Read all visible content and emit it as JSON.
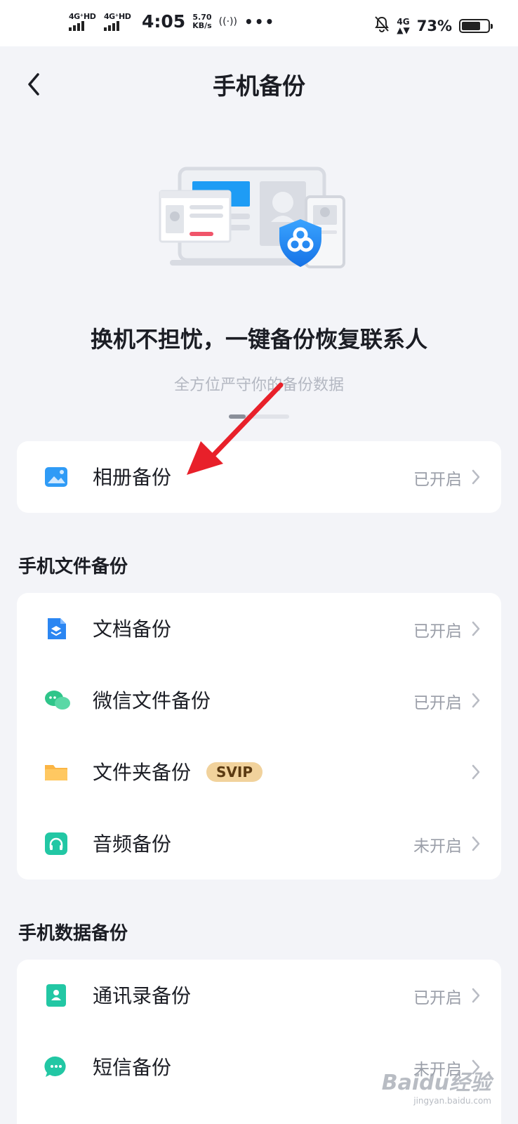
{
  "status_bar": {
    "sim1": "4G⁺HD",
    "sim2": "4G⁺HD",
    "time": "4:05",
    "speed_value": "5.70",
    "speed_unit": "KB/s",
    "more": "•••",
    "data_net": "4G",
    "battery_percent": "73%",
    "battery_level": 0.73
  },
  "header": {
    "title": "手机备份"
  },
  "hero": {
    "headline": "换机不担忧，一键备份恢复联系人",
    "subline": "全方位严守你的备份数据"
  },
  "top_card": {
    "items": [
      {
        "label": "相册备份",
        "status": "已开启",
        "icon": "photo-icon"
      }
    ]
  },
  "sections": [
    {
      "title": "手机文件备份",
      "items": [
        {
          "label": "文档备份",
          "status": "已开启",
          "icon": "document-icon"
        },
        {
          "label": "微信文件备份",
          "status": "已开启",
          "icon": "wechat-icon"
        },
        {
          "label": "文件夹备份",
          "badge": "SVIP",
          "status": "",
          "icon": "folder-icon"
        },
        {
          "label": "音频备份",
          "status": "未开启",
          "icon": "headphones-icon"
        }
      ]
    },
    {
      "title": "手机数据备份",
      "items": [
        {
          "label": "通讯录备份",
          "status": "已开启",
          "icon": "contacts-icon"
        },
        {
          "label": "短信备份",
          "status": "未开启",
          "icon": "sms-icon"
        }
      ]
    }
  ],
  "watermark": {
    "brand": "Baidu经验",
    "site": "jingyan.baidu.com"
  },
  "colors": {
    "background": "#f3f4f8",
    "accent_blue": "#1e8cf5",
    "badge_gold": "#f1d29c",
    "arrow_red": "#e8202a"
  }
}
